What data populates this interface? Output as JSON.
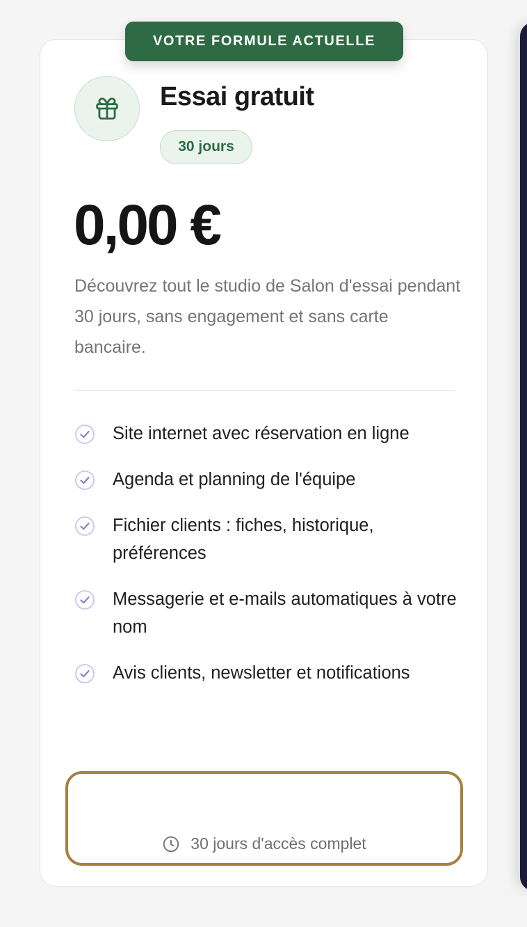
{
  "badge": {
    "current_plan": "VOTRE FORMULE ACTUELLE"
  },
  "plan": {
    "icon": "gift-icon",
    "title": "Essai gratuit",
    "duration": "30 jours",
    "price": "0,00 €",
    "description": "Découvrez tout le studio de Salon d'essai pendant 30 jours, sans engagement et sans carte bancaire."
  },
  "features": [
    {
      "icon": "check-circle-icon",
      "text": "Site internet avec réservation en ligne"
    },
    {
      "icon": "check-circle-icon",
      "text": "Agenda et planning de l'équipe"
    },
    {
      "icon": "check-circle-icon",
      "text": "Fichier clients : fiches, historique, préférences"
    },
    {
      "icon": "check-circle-icon",
      "text": "Messagerie et e-mails automatiques à votre nom"
    },
    {
      "icon": "check-circle-icon",
      "text": "Avis clients, newsletter et notifications"
    }
  ],
  "cta": {
    "icon": "clock-icon",
    "note": "30 jours d'accès complet"
  },
  "colors": {
    "brand_green": "#2e6b45",
    "pill_background": "#eaf4ec",
    "check_purple": "#8b7fd4",
    "cta_border_gold": "#a58240",
    "adjacent_card_navy": "#1c1a38"
  }
}
